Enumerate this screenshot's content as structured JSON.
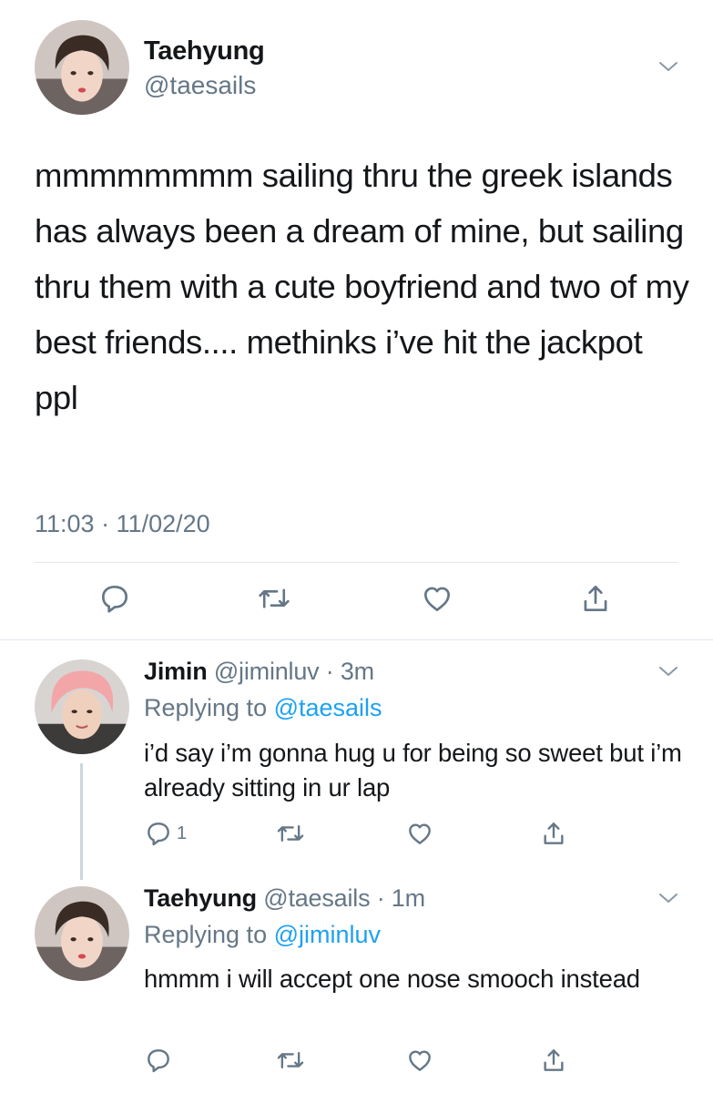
{
  "main_tweet": {
    "name": "Taehyung",
    "handle": "@taesails",
    "text": "mmmmmmmm sailing thru the greek islands has always been a dream of mine, but sailing thru them with a cute boyfriend and two of my best friends.... methinks i’ve hit the jackpot ppl",
    "timestamp": "11:03 · 11/02/20",
    "actions": [
      "reply-icon",
      "retweet-icon",
      "like-icon",
      "share-icon"
    ]
  },
  "replies": [
    {
      "name": "Jimin",
      "meta": "@jiminluv · 3m",
      "replying_prefix": "Replying to ",
      "replying_to": "@taesails",
      "text": "i’d say i’m gonna hug u for being so sweet but i’m already sitting in ur lap",
      "reply_count": "1",
      "avatar_hair_color": "#f2a6a8"
    },
    {
      "name": "Taehyung",
      "meta": "@taesails · 1m",
      "replying_prefix": "Replying to ",
      "replying_to": "@jiminluv",
      "text": "hmmm i will accept one nose smooch instead",
      "reply_count": "",
      "avatar_hair_color": "#3a2b25"
    }
  ],
  "colors": {
    "text": "#14171a",
    "secondary": "#657786",
    "link": "#1da1f2",
    "divider": "#e1e8ed"
  }
}
